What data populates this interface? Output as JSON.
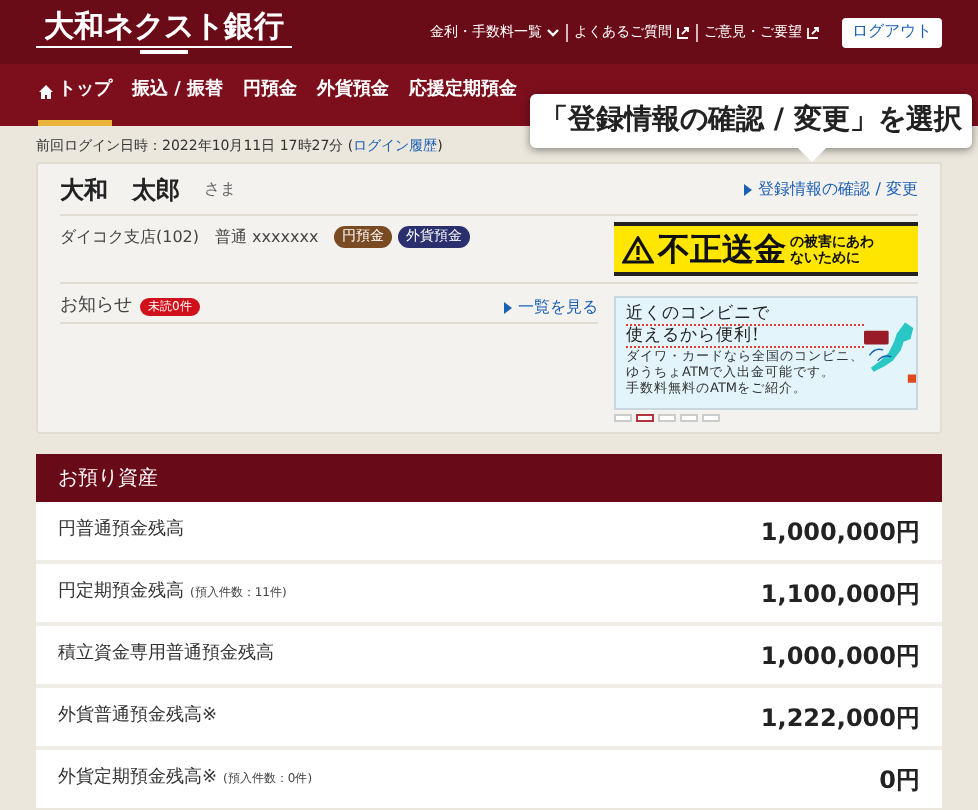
{
  "header": {
    "logo": "大和ネクスト銀行",
    "links": [
      {
        "label": "金利・手数料一覧",
        "kind": "dropdown"
      },
      {
        "label": "よくあるご質問",
        "kind": "external"
      },
      {
        "label": "ご意見・ご要望",
        "kind": "external"
      }
    ],
    "logout": "ログアウト"
  },
  "nav": [
    {
      "label": "トップ",
      "kind": "home",
      "selected": true
    },
    {
      "label": "振込 / 振替",
      "kind": "plain",
      "selected": false
    },
    {
      "label": "円預金",
      "kind": "plain",
      "selected": false
    },
    {
      "label": "外貨預金",
      "kind": "plain",
      "selected": false
    },
    {
      "label": "応援定期預金",
      "kind": "plain",
      "selected": false
    }
  ],
  "callout": "「登録情報の確認 / 変更」を選択",
  "login_info": {
    "label": "前回ログイン日時：2022年10月11日 17時27分 (",
    "link": "ログイン履歴",
    "end": ")"
  },
  "profile": {
    "name": "大和　太郎",
    "honorific": "さま",
    "edit_link": "登録情報の確認 / 変更",
    "branch": "ダイコク支店(102)",
    "account": "普通 xxxxxxx",
    "tags": [
      {
        "label": "円預金",
        "color": "#7a4a22"
      },
      {
        "label": "外貨預金",
        "color": "#2a2f6e"
      }
    ]
  },
  "fraud_banner": {
    "headline": "不正送金",
    "subline": "の被害にあわないために"
  },
  "notices": {
    "title": "お知らせ",
    "badge": "未読0件",
    "link": "一覧を見る"
  },
  "convenience_banner": {
    "headline": [
      "近くのコンビニで",
      "使えるから便利!"
    ],
    "body": [
      "ダイワ・カードなら全国のコンビニ、",
      "ゆうちょATMで入出金可能です。",
      "手数料無料のATMをご紹介。"
    ]
  },
  "carousel": [
    {
      "selected": false
    },
    {
      "selected": true
    },
    {
      "selected": false
    },
    {
      "selected": false
    },
    {
      "selected": false
    }
  ],
  "assets": {
    "title": "お預り資産",
    "rows": [
      {
        "label": "円普通預金残高",
        "amount": "1,000,000円"
      },
      {
        "label": "円定期預金残高",
        "note": "(預入件数：11件)",
        "amount": "1,100,000円"
      },
      {
        "label": "積立資金専用普通預金残高",
        "amount": "1,000,000円"
      },
      {
        "label": "外貨普通預金残高※",
        "amount": "1,222,000円"
      },
      {
        "label": "外貨定期預金残高※",
        "note": "(預入件数：0件)",
        "amount": "0円"
      }
    ]
  }
}
